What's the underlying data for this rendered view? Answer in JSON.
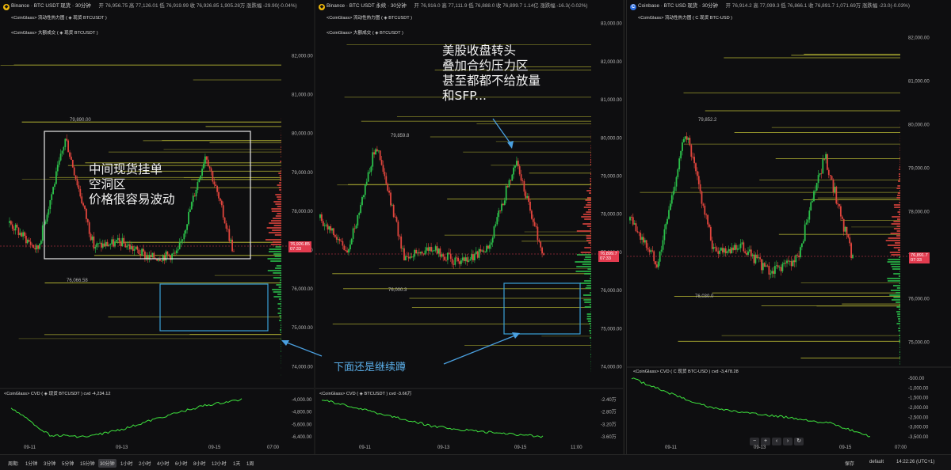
{
  "panels": [
    {
      "title": "Binance · BTC USDT 现货 · 30分钟",
      "ohlc": "开 76,956.75  高 77,126.01  低 76,919.99  收 76,926.85  1,905.28万  涨跌幅 -29.90(-0.04%)",
      "heatmap_label": "<CoinGlass> 流动性热力图 ( ◈ 现货 BTCUSDT )",
      "large_trades_label": "<CoinGlass> 大额成交 ( ◈ 现货 BTCUSDT )",
      "cvd_label": "<CoinGlass> CVD ( ◈ 现货 BTCUSDT )  cvd  -4,234.12",
      "price_axis": [
        "82,000.00",
        "81,000.00",
        "80,000.00",
        "79,000.00",
        "78,000.00",
        "77,000.00",
        "76,000.00",
        "75,000.00",
        "74,000.00"
      ],
      "cvd_axis": [
        "-4,000.00",
        "-4,800.00",
        "-5,600.00",
        "-6,400.00"
      ],
      "last_price": "76,926.85",
      "countdown": "07:33",
      "high_label": "79,890.00",
      "low_label": "76,066.58",
      "x_ticks": [
        "09-11",
        "09-13",
        "09-15",
        "07:00"
      ]
    },
    {
      "title": "Binance · BTC USDT 永续 · 30分钟",
      "ohlc": "开 76,916.0  高 77,111.9  低 76,888.0  收 76,899.7  1.14亿  涨跌幅 -16.3(-0.02%)",
      "heatmap_label": "<CoinGlass> 流动性热力图 ( ◈ BTCUSDT )",
      "large_trades_label": "<CoinGlass> 大额成交 ( ◈ BTCUSDT )",
      "cvd_label": "<CoinGlass> CVD ( ◈ BTCUSDT )  cvd  -3.66万",
      "price_axis": [
        "83,000.00",
        "82,000.00",
        "81,000.00",
        "80,000.00",
        "79,000.00",
        "78,000.00",
        "77,000.00",
        "76,000.00",
        "75,000.00",
        "74,000.00"
      ],
      "cvd_axis": [
        "-2.40万",
        "-2.80万",
        "-3.20万",
        "-3.60万"
      ],
      "last_price": "76,899.7",
      "countdown": "07:33",
      "high_label": "79,859.8",
      "low_label": "76,000.3",
      "x_ticks": [
        "09-11",
        "09-13",
        "09-15",
        "11:00"
      ]
    },
    {
      "title": "Coinbase · BTC USD 现货 · 30分钟",
      "ohlc": "开 76,914.2  高 77,099.3  低 76,866.1  收 76,891.7  1,071.69万  涨跌幅 -23.0(-0.03%)",
      "heatmap_label": "<CoinGlass> 流动性热力图 ( C 现货 BTC-USD )",
      "cvd_label": "<CoinGlass> CVD ( C 现货 BTC-USD )  cvd  -3,478.28",
      "price_axis": [
        "82,000.00",
        "81,000.00",
        "80,000.00",
        "79,000.00",
        "78,000.00",
        "77,000.00",
        "76,000.00",
        "75,000.00"
      ],
      "cvd_axis": [
        "-500.00",
        "-1,000.00",
        "-1,500.00",
        "-2,000.00",
        "-2,500.00",
        "-3,000.00",
        "-3,500.00"
      ],
      "last_price": "76,891.7",
      "countdown": "07:33",
      "high_label": "79,852.2",
      "low_label": "76,030.0",
      "x_ticks": [
        "09-11",
        "09-13",
        "09-15",
        "07:00"
      ]
    }
  ],
  "annotations": {
    "box_note": "中间现货挂单\n空洞区\n价格很容易波动",
    "top_note": "美股收盘转头\n叠加合约压力区\n甚至都都不给放量\n和SFP...",
    "bottom_note": "下面还是继续蹲"
  },
  "toolbar": {
    "period_label": "周期:",
    "intervals": [
      "1分钟",
      "3分钟",
      "5分钟",
      "15分钟",
      "30分钟",
      "1小时",
      "2小时",
      "4小时",
      "6小时",
      "8小时",
      "12小时",
      "1天",
      "1周"
    ],
    "selected": "30分钟",
    "save": "保存",
    "layout": "default",
    "clock": "14:22:26 (UTC+1)"
  },
  "nav_buttons": [
    "−",
    "+",
    "‹",
    "›",
    "↻"
  ],
  "colors": {
    "up": "#2bbf4a",
    "down": "#e0453d",
    "cvd": "#3ee23e",
    "liquidity": "#d8d83a",
    "annotation_box": "#e8e8e8",
    "zone_box": "#3aa0d8",
    "last_price": "#e23b4f"
  },
  "chart_data": [
    {
      "type": "line",
      "title": "Binance · BTC USDT 现货 · 30分钟",
      "x": [
        "09-11",
        "09-13",
        "09-15"
      ],
      "series": [
        {
          "name": "price",
          "values": [
            77700,
            77000,
            79890,
            77100,
            77200,
            76800,
            76900,
            79500,
            76926.85
          ]
        },
        {
          "name": "CVD",
          "values": [
            -4700,
            -6300,
            -6400,
            -5900,
            -5200,
            -4600,
            -4234.12
          ]
        }
      ],
      "ylim": [
        74000,
        82500
      ]
    },
    {
      "type": "line",
      "title": "Binance · BTC USDT 永续 · 30分钟",
      "x": [
        "09-11",
        "09-13",
        "09-15"
      ],
      "series": [
        {
          "name": "price",
          "values": [
            77900,
            77000,
            79859.8,
            76900,
            77100,
            76700,
            77100,
            79400,
            76899.7
          ]
        },
        {
          "name": "CVD",
          "values": [
            -24000,
            -27000,
            -30000,
            -33000,
            -34500,
            -35500,
            -36600
          ]
        }
      ],
      "ylim": [
        74000,
        83200
      ]
    },
    {
      "type": "line",
      "title": "Coinbase · BTC USD 现货 · 30分钟",
      "x": [
        "09-11",
        "09-13",
        "09-15"
      ],
      "series": [
        {
          "name": "price",
          "values": [
            77800,
            76800,
            79852.2,
            77100,
            77200,
            76600,
            76900,
            79300,
            76891.7
          ]
        },
        {
          "name": "CVD",
          "values": [
            -500,
            -1300,
            -2000,
            -2300,
            -2500,
            -2800,
            -3478.28
          ]
        }
      ],
      "ylim": [
        74600,
        82200
      ]
    }
  ]
}
